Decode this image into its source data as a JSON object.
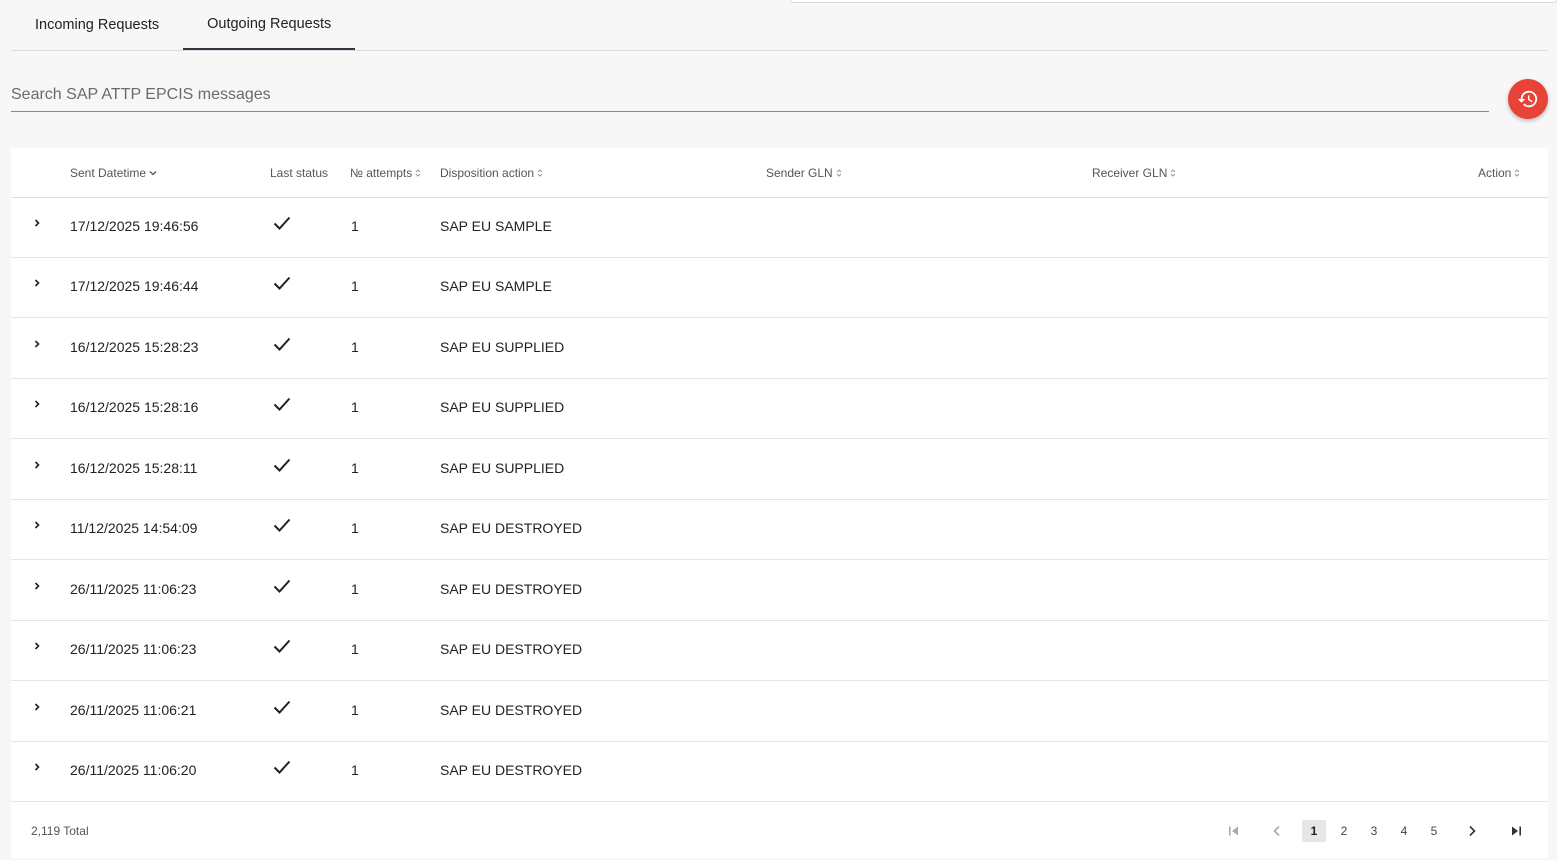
{
  "tabs": [
    {
      "label": "Incoming Requests",
      "active": false
    },
    {
      "label": "Outgoing Requests",
      "active": true
    }
  ],
  "search": {
    "placeholder": "Search SAP ATTP EPCIS messages",
    "value": ""
  },
  "history_button": {
    "icon": "history-icon",
    "color": "#e84336"
  },
  "table": {
    "headers": {
      "sent_datetime": "Sent Datetime",
      "last_status": "Last status",
      "attempts": "№ attempts",
      "disposition": "Disposition action",
      "sender_gln": "Sender GLN",
      "receiver_gln": "Receiver GLN",
      "action": "Action"
    },
    "rows": [
      {
        "sent": "17/12/2025 19:46:56",
        "status": "check-icon",
        "attempts": "1",
        "disposition": "SAP EU SAMPLE",
        "sender_gln": "",
        "receiver_gln": "",
        "action": ""
      },
      {
        "sent": "17/12/2025 19:46:44",
        "status": "check-icon",
        "attempts": "1",
        "disposition": "SAP EU SAMPLE",
        "sender_gln": "",
        "receiver_gln": "",
        "action": ""
      },
      {
        "sent": "16/12/2025 15:28:23",
        "status": "check-icon",
        "attempts": "1",
        "disposition": "SAP EU SUPPLIED",
        "sender_gln": "",
        "receiver_gln": "",
        "action": ""
      },
      {
        "sent": "16/12/2025 15:28:16",
        "status": "check-icon",
        "attempts": "1",
        "disposition": "SAP EU SUPPLIED",
        "sender_gln": "",
        "receiver_gln": "",
        "action": ""
      },
      {
        "sent": "16/12/2025 15:28:11",
        "status": "check-icon",
        "attempts": "1",
        "disposition": "SAP EU SUPPLIED",
        "sender_gln": "",
        "receiver_gln": "",
        "action": ""
      },
      {
        "sent": "11/12/2025 14:54:09",
        "status": "check-icon",
        "attempts": "1",
        "disposition": "SAP EU DESTROYED",
        "sender_gln": "",
        "receiver_gln": "",
        "action": ""
      },
      {
        "sent": "26/11/2025 11:06:23",
        "status": "check-icon",
        "attempts": "1",
        "disposition": "SAP EU DESTROYED",
        "sender_gln": "",
        "receiver_gln": "",
        "action": ""
      },
      {
        "sent": "26/11/2025 11:06:23",
        "status": "check-icon",
        "attempts": "1",
        "disposition": "SAP EU DESTROYED",
        "sender_gln": "",
        "receiver_gln": "",
        "action": ""
      },
      {
        "sent": "26/11/2025 11:06:21",
        "status": "check-icon",
        "attempts": "1",
        "disposition": "SAP EU DESTROYED",
        "sender_gln": "",
        "receiver_gln": "",
        "action": ""
      },
      {
        "sent": "26/11/2025 11:06:20",
        "status": "check-icon",
        "attempts": "1",
        "disposition": "SAP EU DESTROYED",
        "sender_gln": "",
        "receiver_gln": "",
        "action": ""
      }
    ]
  },
  "footer": {
    "total": "2,119 Total",
    "pages": [
      "1",
      "2",
      "3",
      "4",
      "5"
    ],
    "current_page": "1"
  }
}
